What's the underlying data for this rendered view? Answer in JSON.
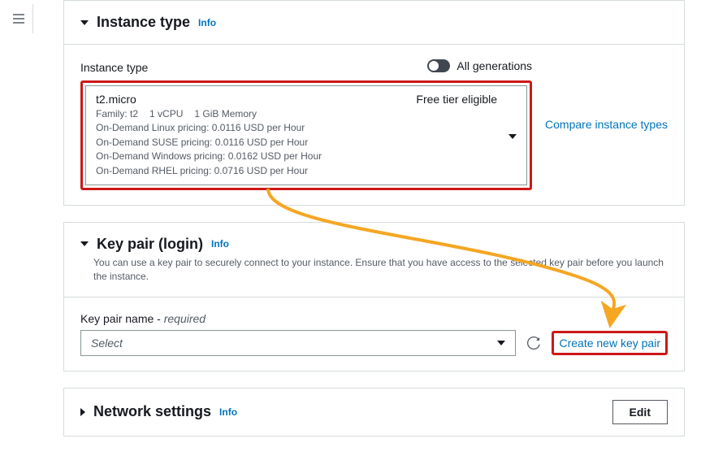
{
  "sections": {
    "instance_type": {
      "title": "Instance type",
      "info": "Info",
      "field_label": "Instance type",
      "all_generations_label": "All generations",
      "compare_link": "Compare instance types",
      "selected": {
        "name": "t2.micro",
        "badge": "Free tier eligible",
        "family": "Family: t2",
        "vcpu": "1 vCPU",
        "memory": "1 GiB Memory",
        "pricing_linux": "On-Demand Linux pricing: 0.0116 USD per Hour",
        "pricing_suse": "On-Demand SUSE pricing: 0.0116 USD per Hour",
        "pricing_windows": "On-Demand Windows pricing: 0.0162 USD per Hour",
        "pricing_rhel": "On-Demand RHEL pricing: 0.0716 USD per Hour"
      }
    },
    "key_pair": {
      "title": "Key pair (login)",
      "info": "Info",
      "description": "You can use a key pair to securely connect to your instance. Ensure that you have access to the selected key pair before you launch the instance.",
      "field_label": "Key pair name - ",
      "required": "required",
      "placeholder": "Select",
      "create_link": "Create new key pair"
    },
    "network": {
      "title": "Network settings",
      "info": "Info",
      "edit_button": "Edit"
    }
  }
}
